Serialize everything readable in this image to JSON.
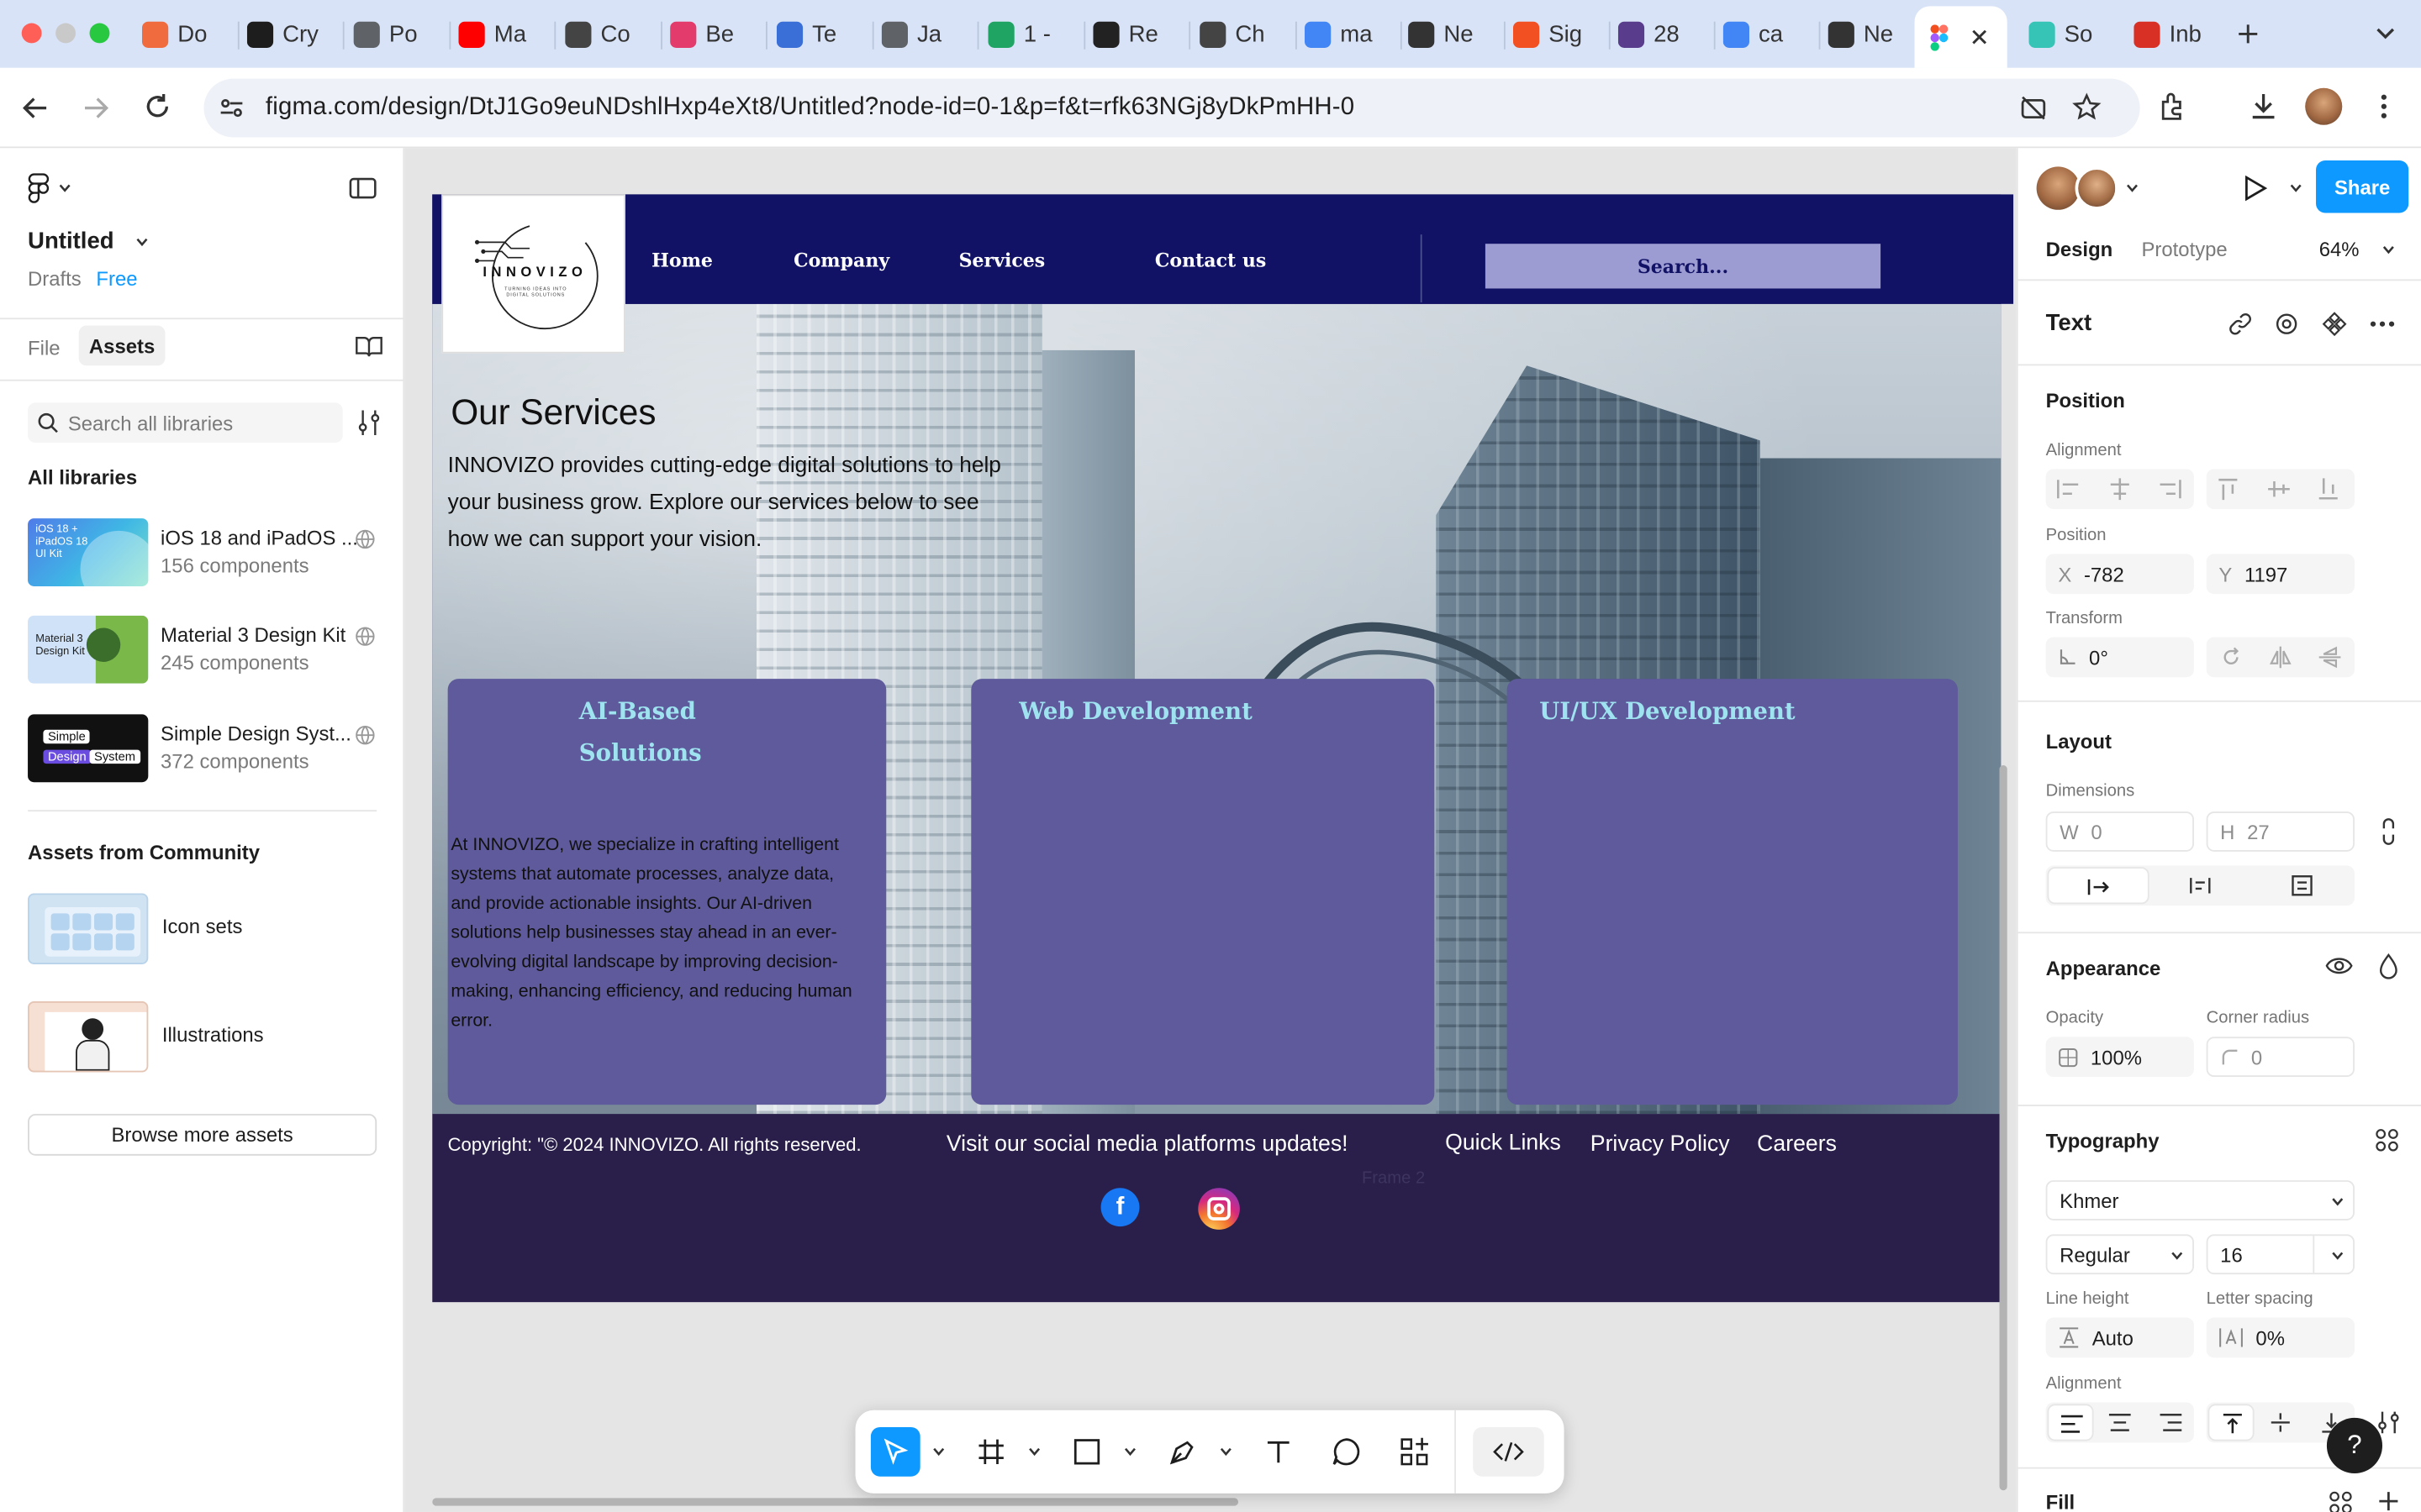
{
  "browser": {
    "tabs": [
      {
        "label": "Do",
        "icon": "circle-logo-icon",
        "color": "#f06b3e"
      },
      {
        "label": "Cry",
        "icon": "leaf-logo-icon",
        "color": "#1d1d1d"
      },
      {
        "label": "Po",
        "icon": "globe-icon",
        "color": "#5f6368"
      },
      {
        "label": "Ma",
        "icon": "youtube-icon",
        "color": "#ff0000"
      },
      {
        "label": "Co",
        "icon": "openai-icon",
        "color": "#444444"
      },
      {
        "label": "Be",
        "icon": "code-icon",
        "color": "#e33b6c"
      },
      {
        "label": "Te",
        "icon": "person-card-icon",
        "color": "#3b6fd8"
      },
      {
        "label": "Ja",
        "icon": "globe-icon",
        "color": "#5f6368"
      },
      {
        "label": "1 -",
        "icon": "drive-icon",
        "color": "#1fa463"
      },
      {
        "label": "Re",
        "icon": "react-icon",
        "color": "#222222"
      },
      {
        "label": "Ch",
        "icon": "openai-icon",
        "color": "#444444"
      },
      {
        "label": "ma",
        "icon": "google-icon",
        "color": "#4285f4"
      },
      {
        "label": "Ne",
        "icon": "github-icon",
        "color": "#333333"
      },
      {
        "label": "Sig",
        "icon": "microsoft-icon",
        "color": "#f25022"
      },
      {
        "label": "28",
        "icon": "colorlib-icon",
        "color": "#5a3c8c"
      },
      {
        "label": "ca",
        "icon": "google-icon",
        "color": "#4285f4"
      },
      {
        "label": "Ne",
        "icon": "github-icon",
        "color": "#333333"
      }
    ],
    "active_tab_icon": "figma-icon",
    "after_tabs": [
      {
        "label": "So",
        "icon": "v-logo-icon",
        "color": "#35c4b5"
      },
      {
        "label": "Inb",
        "icon": "gmail-icon",
        "color": "#d93025"
      }
    ],
    "url": "figma.com/design/DtJ1Go9euNDshlHxp4eXt8/Untitled?node-id=0-1&p=f&t=rfk63NGj8yDkPmHH-0"
  },
  "left_panel": {
    "file_name": "Untitled",
    "drafts": "Drafts",
    "plan": "Free",
    "tab_file": "File",
    "tab_assets": "Assets",
    "search_placeholder": "Search all libraries",
    "all_libraries": "All libraries",
    "libraries": [
      {
        "name": "iOS 18 and iPadOS ...",
        "count": "156 components",
        "thumb_text": "iOS 18 + iPadOS 18 UI Kit"
      },
      {
        "name": "Material 3 Design Kit",
        "count": "245 components",
        "thumb_text": "Material 3 Design Kit"
      },
      {
        "name": "Simple Design Syst...",
        "count": "372 components",
        "thumb_text_1": "Simple",
        "thumb_text_2": "Design",
        "thumb_text_3": "System"
      }
    ],
    "community_heading": "Assets from Community",
    "community": [
      {
        "name": "Icon sets"
      },
      {
        "name": "Illustrations"
      }
    ],
    "browse_button": "Browse more assets"
  },
  "design": {
    "logo_name": "INNOVIZO",
    "logo_tagline": "TURNING IDEAS INTO DIGITAL SOLUTIONS",
    "nav": [
      "Home",
      "Company",
      "Services",
      "Contact us"
    ],
    "search_placeholder": "Search...",
    "hero_title": "Our Services",
    "hero_text": "INNOVIZO provides cutting-edge digital solutions to help your business grow. Explore our services below to see how we can support your vision.",
    "cards": [
      {
        "title": "AI-Based Solutions",
        "body": "At INNOVIZO, we specialize in crafting intelligent systems that automate processes, analyze data, and provide actionable insights. Our AI-driven solutions help businesses stay ahead in an ever-evolving digital landscape by improving decision-making, enhancing efficiency, and reducing human error."
      },
      {
        "title": "Web Development",
        "body": ""
      },
      {
        "title": "UI/UX Development",
        "body": ""
      }
    ],
    "footer_copyright": "Copyright: \"© 2024 INNOVIZO. All rights reserved.",
    "footer_social": "Visit our social media platforms updates!",
    "footer_links": [
      "Quick Links",
      "Privacy Policy",
      "Careers"
    ],
    "frame_label": "Frame 2",
    "colors": {
      "nav": "#111266",
      "card": "#5e5a9b",
      "footer": "#2a1f4a",
      "card_title": "#9ee3ef"
    }
  },
  "right_panel": {
    "tab_design": "Design",
    "tab_prototype": "Prototype",
    "zoom": "64%",
    "share": "Share",
    "selection_type": "Text",
    "position_heading": "Position",
    "alignment_label": "Alignment",
    "position_label": "Position",
    "x_label": "X",
    "x_value": "-782",
    "y_label": "Y",
    "y_value": "1197",
    "transform_label": "Transform",
    "rotation": "0°",
    "layout_heading": "Layout",
    "dimensions_label": "Dimensions",
    "w_label": "W",
    "w_value": "0",
    "h_label": "H",
    "h_value": "27",
    "appearance_heading": "Appearance",
    "opacity_label": "Opacity",
    "opacity_value": "100%",
    "corner_radius_label": "Corner radius",
    "corner_radius_value": "0",
    "typography_heading": "Typography",
    "font_family": "Khmer",
    "font_weight": "Regular",
    "font_size": "16",
    "line_height_label": "Line height",
    "line_height_value": "Auto",
    "letter_spacing_label": "Letter spacing",
    "letter_spacing_value": "0%",
    "text_alignment_label": "Alignment",
    "fill_heading": "Fill",
    "accent": "#0d99ff"
  }
}
